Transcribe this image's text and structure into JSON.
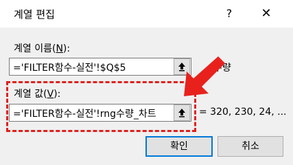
{
  "dialog": {
    "title": "계열 편집",
    "help_glyph": "?",
    "close_glyph": "✕"
  },
  "series_name": {
    "label": "계열 이름(",
    "accel": "N",
    "label_end": "):",
    "value": "='FILTER함수-실전'!$Q$5",
    "preview": "수량"
  },
  "series_values": {
    "label": "계열 값(",
    "accel": "V",
    "label_end": "):",
    "value": "='FILTER함수-실전'!rng수량_차트",
    "preview": "= 320, 230, 24, ..."
  },
  "buttons": {
    "ok": "확인",
    "cancel": "취소"
  },
  "colors": {
    "annotation": "#e0201b",
    "focus": "#0078d7"
  }
}
